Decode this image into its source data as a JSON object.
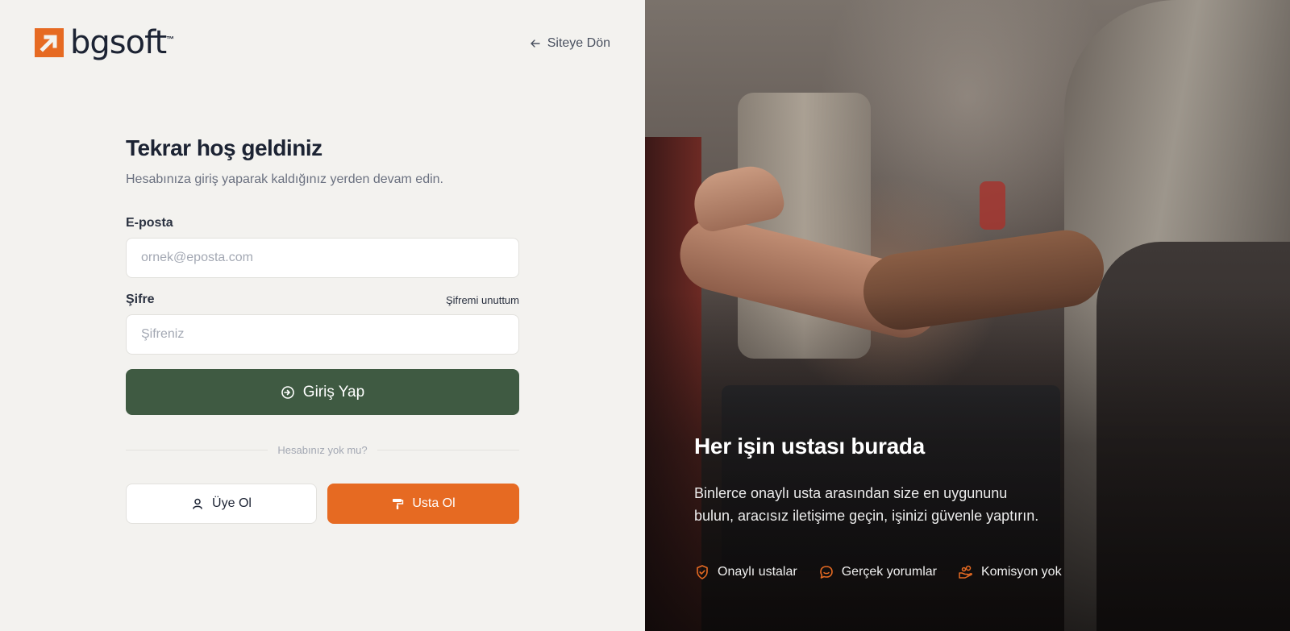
{
  "brand": {
    "name": "bgsoft",
    "tm": "™"
  },
  "header": {
    "back_label": "Siteye Dön"
  },
  "login": {
    "title": "Tekrar hoş geldiniz",
    "subtitle": "Hesabınıza giriş yaparak kaldığınız yerden devam edin.",
    "email_label": "E-posta",
    "email_placeholder": "ornek@eposta.com",
    "password_label": "Şifre",
    "forgot_label": "Şifremi unuttum",
    "password_placeholder": "Şifreniz",
    "submit_label": "Giriş Yap",
    "divider_text": "Hesabınız yok mu?",
    "member_label": "Üye Ol",
    "pro_label": "Usta Ol"
  },
  "hero": {
    "title": "Her işin ustası burada",
    "text": "Binlerce onaylı usta arasından size en uygununu bulun, aracısız iletişime geçin, işinizi güvenle yaptırın.",
    "features": [
      {
        "label": "Onaylı ustalar",
        "icon": "shield-check-icon"
      },
      {
        "label": "Gerçek yorumlar",
        "icon": "chat-bubble-icon"
      },
      {
        "label": "Komisyon yok",
        "icon": "hand-coins-icon"
      }
    ]
  },
  "colors": {
    "accent": "#e66a22",
    "primary": "#3f5a42",
    "background": "#f3f2ef",
    "text": "#1c2333"
  }
}
